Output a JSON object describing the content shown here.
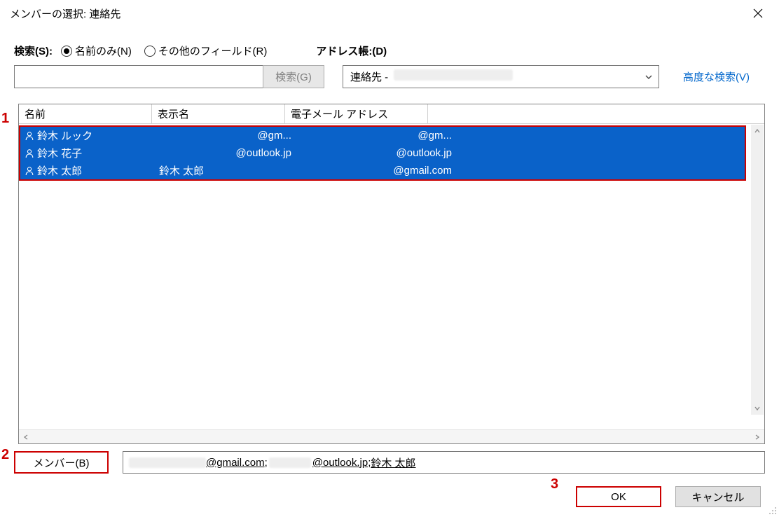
{
  "window": {
    "title": "メンバーの選択: 連絡先"
  },
  "search": {
    "label": "検索(S):",
    "radio_name": "名前のみ(N)",
    "radio_other": "その他のフィールド(R)",
    "button": "検索(G)"
  },
  "addressbook": {
    "label": "アドレス帳:(D)",
    "prefix": "連絡先 - ",
    "advanced": "高度な検索(V)"
  },
  "table": {
    "headers": {
      "name": "名前",
      "display": "表示名",
      "email": "電子メール アドレス"
    },
    "rows": [
      {
        "name": "鈴木 ルック",
        "display": "@gm...",
        "email": "@gm..."
      },
      {
        "name": "鈴木 花子",
        "display": "@outlook.jp",
        "email": "@outlook.jp"
      },
      {
        "name": "鈴木 太郎",
        "display_full": "鈴木 太郎",
        "email": "@gmail.com"
      }
    ]
  },
  "members": {
    "button": "メンバー(B)",
    "seg1": "@gmail.com",
    "seg2": "@outlook.jp",
    "seg_sep1": "; ",
    "seg_sep2": "; ",
    "seg3": "鈴木 太郎"
  },
  "buttons": {
    "ok": "OK",
    "cancel": "キャンセル"
  },
  "annotations": {
    "a1": "1",
    "a2": "2",
    "a3": "3"
  }
}
